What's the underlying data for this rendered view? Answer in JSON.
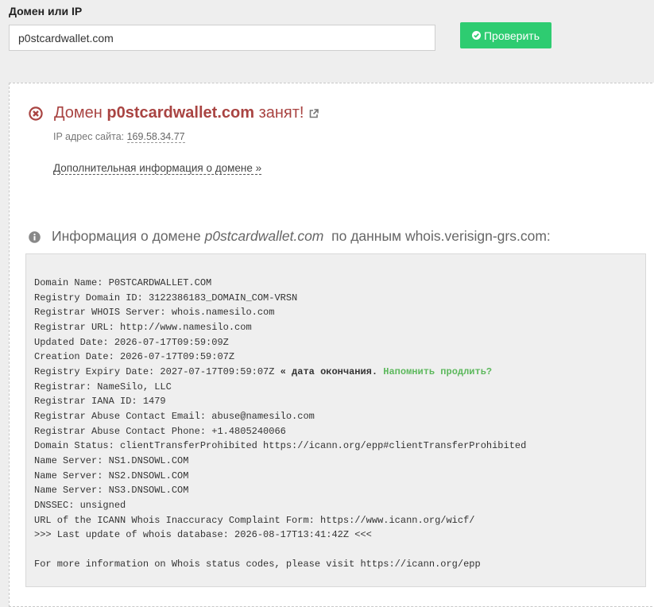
{
  "form": {
    "label": "Домен или IP",
    "input_value": "p0stcardwallet.com",
    "check_button": "Проверить"
  },
  "result": {
    "prefix": "Домен",
    "domain": "p0stcardwallet.com",
    "suffix": "занят!",
    "ip_label": "IP адрес сайта:",
    "ip_value": "169.58.34.77",
    "more_info_link": "Дополнительная информация о домене »"
  },
  "whois": {
    "heading_prefix": "Информация о домене",
    "heading_domain": "p0stcardwallet.com",
    "heading_suffix": "по данным whois.verisign-grs.com:",
    "lines": [
      "Domain Name: P0STCARDWALLET.COM",
      "Registry Domain ID: 3122386183_DOMAIN_COM-VRSN",
      "Registrar WHOIS Server: whois.namesilo.com",
      "Registrar URL: http://www.namesilo.com",
      "Updated Date: 2026-07-17T09:59:09Z",
      "Creation Date: 2026-07-17T09:59:07Z",
      "Registry Expiry Date: 2027-07-17T09:59:07Z",
      "Registrar: NameSilo, LLC",
      "Registrar IANA ID: 1479",
      "Registrar Abuse Contact Email: abuse@namesilo.com",
      "Registrar Abuse Contact Phone: +1.4805240066",
      "Domain Status: clientTransferProhibited https://icann.org/epp#clientTransferProhibited",
      "Name Server: NS1.DNSOWL.COM",
      "Name Server: NS2.DNSOWL.COM",
      "Name Server: NS3.DNSOWL.COM",
      "DNSSEC: unsigned",
      "URL of the ICANN Whois Inaccuracy Complaint Form: https://www.icann.org/wicf/",
      ">>> Last update of whois database: 2026-08-17T13:41:42Z <<<",
      "",
      "For more information on Whois status codes, please visit https://icann.org/epp"
    ],
    "expiry_note": " « дата окончания.",
    "remind_link": "Напомнить продлить?"
  },
  "colors": {
    "busy": "#a94442",
    "button": "#2ecc71",
    "remind": "#5cb85c"
  }
}
